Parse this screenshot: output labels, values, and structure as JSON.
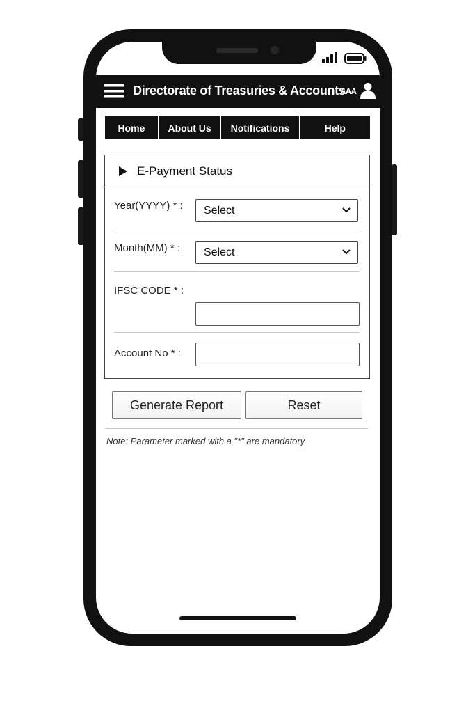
{
  "header": {
    "title": "Directorate of Treasuries & Accounts",
    "font_size_label": "AAA"
  },
  "nav": {
    "items": [
      {
        "label": "Home"
      },
      {
        "label": "About Us"
      },
      {
        "label": "Notifications"
      },
      {
        "label": "Help"
      }
    ]
  },
  "panel": {
    "title": "E-Payment Status",
    "fields": {
      "year": {
        "label": "Year(YYYY) * :",
        "value": "Select"
      },
      "month": {
        "label": "Month(MM) * :",
        "value": "Select"
      },
      "ifsc": {
        "label": "IFSC CODE * :",
        "value": ""
      },
      "account": {
        "label": "Account No * :",
        "value": ""
      }
    }
  },
  "actions": {
    "generate_label": "Generate Report",
    "reset_label": "Reset"
  },
  "note": "Note: Parameter marked with a \"*\" are mandatory",
  "icons": {
    "menu": "hamburger-menu-icon",
    "user": "user-icon",
    "expand": "triangle-right-icon",
    "dropdown": "chevron-down-icon",
    "signal": "cell-signal-icon",
    "battery": "battery-icon"
  },
  "colors": {
    "header_bg": "#111111",
    "nav_bg": "#111111",
    "text": "#111111"
  }
}
